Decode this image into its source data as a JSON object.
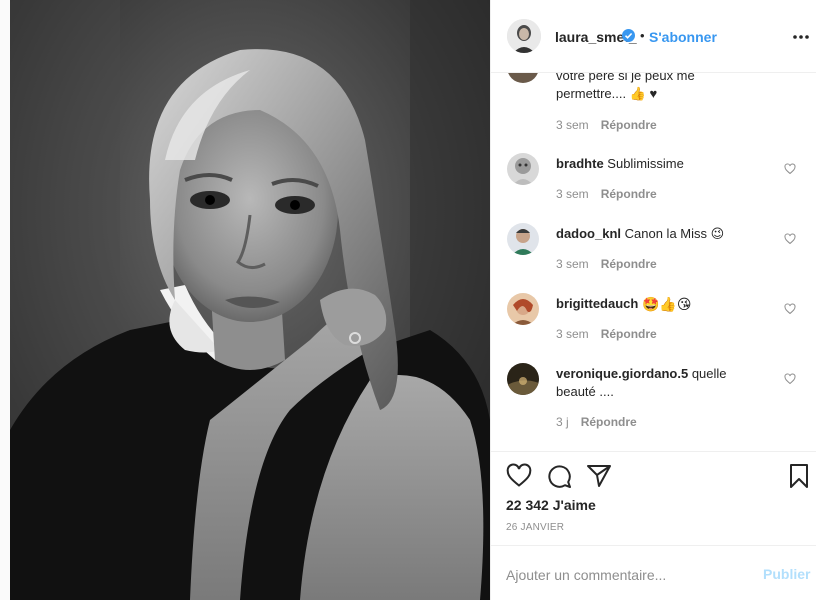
{
  "post": {
    "image_icon": "portrait-photo",
    "header": {
      "username": "laura_smet_",
      "verified_icon": "verified-badge-icon",
      "separator": "•",
      "follow_label": "S'abonner",
      "more_icon": "more-options-icon"
    },
    "comments": [
      {
        "username": "",
        "text": "votre père si je peux me permettre.... 👍 ♥",
        "time": "3 sem",
        "reply": "Répondre"
      },
      {
        "username": "bradhte",
        "text": "Sublimissime",
        "time": "3 sem",
        "reply": "Répondre"
      },
      {
        "username": "dadoo_knl",
        "text": "Canon la Miss 😉",
        "time": "3 sem",
        "reply": "Répondre"
      },
      {
        "username": "brigittedauch",
        "text": "🤩👍😘",
        "time": "3 sem",
        "reply": "Répondre"
      },
      {
        "username": "veronique.giordano.5",
        "text": "quelle beauté ....",
        "time": "3 j",
        "reply": "Répondre"
      }
    ],
    "actions": {
      "like_icon": "heart-icon",
      "comment_icon": "comment-bubble-icon",
      "share_icon": "share-paper-plane-icon",
      "save_icon": "bookmark-icon",
      "likes_text": "22 342 J'aime",
      "date": "26 JANVIER"
    },
    "comment_box": {
      "placeholder": "Ajouter un commentaire...",
      "publish_label": "Publier"
    },
    "colors": {
      "link_blue": "#3897f0",
      "publish_disabled": "#b2dffc",
      "muted": "#8e8e8e",
      "text": "#262626",
      "border": "#efefef"
    }
  }
}
